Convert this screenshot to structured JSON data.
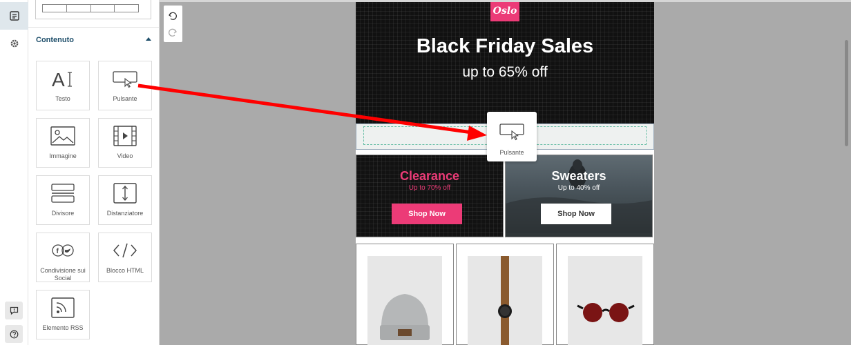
{
  "sidebar": {
    "section_title": "Contenuto",
    "blocks": [
      {
        "label": "Testo",
        "icon": "text-icon"
      },
      {
        "label": "Pulsante",
        "icon": "button-icon"
      },
      {
        "label": "Immagine",
        "icon": "image-icon"
      },
      {
        "label": "Video",
        "icon": "video-icon"
      },
      {
        "label": "Divisore",
        "icon": "divider-icon"
      },
      {
        "label": "Distanziatore",
        "icon": "spacer-icon"
      },
      {
        "label": "Condivisione sui Social",
        "icon": "social-share-icon"
      },
      {
        "label": "Blocco HTML",
        "icon": "html-code-icon"
      },
      {
        "label": "Elemento RSS",
        "icon": "rss-icon"
      }
    ]
  },
  "email": {
    "logo_text": "Oslo",
    "hero_title": "Black Friday Sales",
    "hero_subtitle": "up to 65% off",
    "promos": [
      {
        "title": "Clearance",
        "subtitle": "Up to 70% off",
        "button": "Shop Now"
      },
      {
        "title": "Sweaters",
        "subtitle": "Up to 40% off",
        "button": "Shop Now"
      }
    ]
  },
  "drag_ghost": {
    "label": "Pulsante"
  },
  "colors": {
    "accent_pink": "#ec3b77",
    "annotation_arrow": "#ff0000",
    "panel_title": "#1f4f6b",
    "canvas_bg": "#aaaaaa"
  }
}
